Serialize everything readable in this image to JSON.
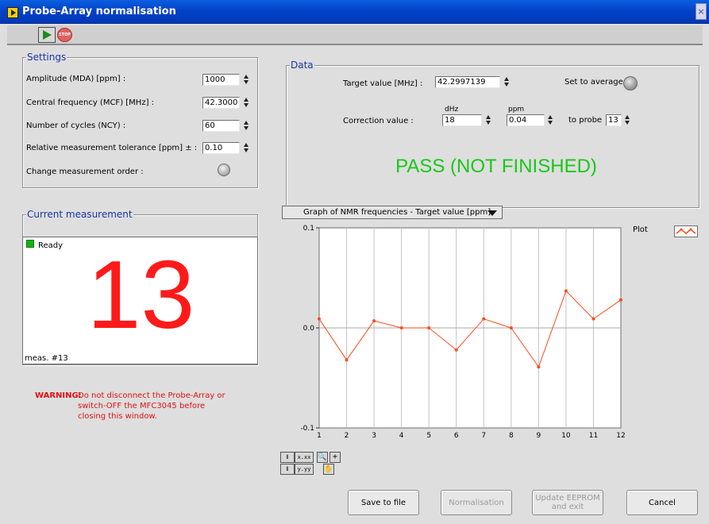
{
  "window": {
    "title": "Probe-Array normalisation",
    "close_label": "×"
  },
  "toolbar": {
    "stop_label": "STOP"
  },
  "settings": {
    "title": "Settings",
    "amplitude_label": "Amplitude (MDA)  [ppm] :",
    "amplitude_value": "1000",
    "central_freq_label": "Central frequency (MCF)  [MHz] :",
    "central_freq_value": "42.3000",
    "cycles_label": "Number of cycles (NCY) :",
    "cycles_value": "60",
    "tolerance_label": "Relative measurement tolerance [ppm] ± :",
    "tolerance_value": "0.10",
    "order_label": "Change measurement order :"
  },
  "current": {
    "title": "Current measurement",
    "status": "Ready",
    "number": "13",
    "footer": "meas. #13"
  },
  "warning": {
    "head": "WARNING:",
    "line1": "Do not disconnect the Probe-Array or",
    "line2": "switch-OFF the MFC3045 before",
    "line3": "closing this window."
  },
  "data": {
    "title": "Data",
    "target_label": "Target value [MHz] :",
    "target_value": "42.2997139",
    "set_avg_label": "Set to average",
    "correction_label": "Correction value :",
    "dhz_unit": "dHz",
    "dhz_value": "18",
    "ppm_unit": "ppm",
    "ppm_value": "0.04",
    "to_probe_label": "to probe",
    "to_probe_value": "13",
    "status": "PASS (NOT FINISHED)"
  },
  "graph": {
    "selector": "Graph of NMR frequencies - Target value [ppm]",
    "legend_label": "Plot"
  },
  "palette": {
    "x_fmt": "x.xx",
    "y_fmt": "y.yy"
  },
  "buttons": {
    "save": "Save to file",
    "normalisation": "Normalisation",
    "update_line1": "Update EEPROM",
    "update_line2": "and exit",
    "cancel": "Cancel"
  },
  "colors": {
    "series": "#ff4a1c",
    "pass": "#18c818",
    "warning": "#e01010",
    "title_bar": "#0342c8"
  },
  "chart_data": {
    "type": "line",
    "x": [
      1,
      2,
      3,
      4,
      5,
      6,
      7,
      8,
      9,
      10,
      11,
      12
    ],
    "series": [
      {
        "values": [
          0.009,
          -0.032,
          0.007,
          0.0,
          0.0,
          -0.022,
          0.009,
          0.0,
          -0.039,
          0.037,
          0.009,
          0.028
        ]
      }
    ],
    "xlim": [
      1,
      12
    ],
    "ylim": [
      -0.1,
      0.1
    ],
    "x_ticks": [
      "1",
      "2",
      "3",
      "4",
      "5",
      "6",
      "7",
      "8",
      "9",
      "10",
      "11",
      "12"
    ],
    "y_ticks": [
      "0.1",
      "0.0",
      "-0.1"
    ],
    "grid": "vertical"
  }
}
